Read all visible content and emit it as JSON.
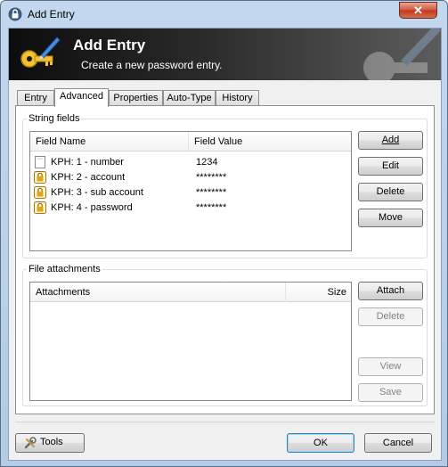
{
  "window": {
    "title": "Add Entry",
    "close_glyph": "✕"
  },
  "banner": {
    "title": "Add Entry",
    "subtitle": "Create a new password entry.",
    "icon": "key-pen-icon"
  },
  "tabs": [
    {
      "label": "Entry"
    },
    {
      "label": "Advanced"
    },
    {
      "label": "Properties"
    },
    {
      "label": "Auto-Type"
    },
    {
      "label": "History"
    }
  ],
  "string_fields": {
    "group_label": "String fields",
    "columns": [
      "Field Name",
      "Field Value"
    ],
    "rows": [
      {
        "name": "KPH: 1 - number",
        "value": "1234",
        "icon": "blank-document-icon"
      },
      {
        "name": "KPH: 2 - account",
        "value": "********",
        "icon": "lock-icon"
      },
      {
        "name": "KPH: 3 - sub account",
        "value": "********",
        "icon": "lock-icon"
      },
      {
        "name": "KPH: 4 - password",
        "value": "********",
        "icon": "lock-icon"
      }
    ],
    "buttons": {
      "add": "Add",
      "edit": "Edit",
      "delete": "Delete",
      "move": "Move"
    }
  },
  "file_attachments": {
    "group_label": "File attachments",
    "columns": [
      "Attachments",
      "Size"
    ],
    "buttons": {
      "attach": "Attach",
      "delete": "Delete",
      "view": "View",
      "save": "Save"
    }
  },
  "footer": {
    "tools": "Tools",
    "ok": "OK",
    "cancel": "Cancel"
  },
  "colors": {
    "accent": "#3c7fb1",
    "banner_dark": "#0d0d0d",
    "lock_gold": "#e2a21c"
  }
}
